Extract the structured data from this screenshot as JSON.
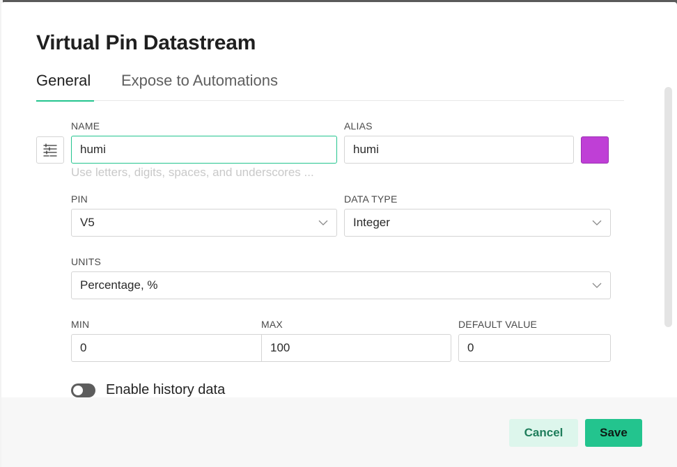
{
  "dialog": {
    "title": "Virtual Pin Datastream",
    "tabs": [
      {
        "label": "General",
        "active": true
      },
      {
        "label": "Expose to Automations",
        "active": false
      }
    ]
  },
  "form": {
    "name": {
      "label": "NAME",
      "value": "humi",
      "hint": "Use letters, digits, spaces, and underscores ..."
    },
    "alias": {
      "label": "ALIAS",
      "value": "humi"
    },
    "color": {
      "hex": "#bf3fd6"
    },
    "pin": {
      "label": "PIN",
      "value": "V5"
    },
    "data_type": {
      "label": "DATA TYPE",
      "value": "Integer"
    },
    "units": {
      "label": "UNITS",
      "value": "Percentage, %"
    },
    "min": {
      "label": "MIN",
      "value": "0"
    },
    "max": {
      "label": "MAX",
      "value": "100"
    },
    "default_value": {
      "label": "DEFAULT VALUE",
      "value": "0"
    },
    "history": {
      "label": "Enable history data",
      "enabled": false
    }
  },
  "footer": {
    "cancel_label": "Cancel",
    "save_label": "Save"
  },
  "colors": {
    "accent": "#23c48e",
    "cancel_bg": "#ddf6ec",
    "toggle_off": "#5d5d5d"
  },
  "icons": {
    "settings": "sliders-icon",
    "dropdown": "chevron-down-icon"
  }
}
